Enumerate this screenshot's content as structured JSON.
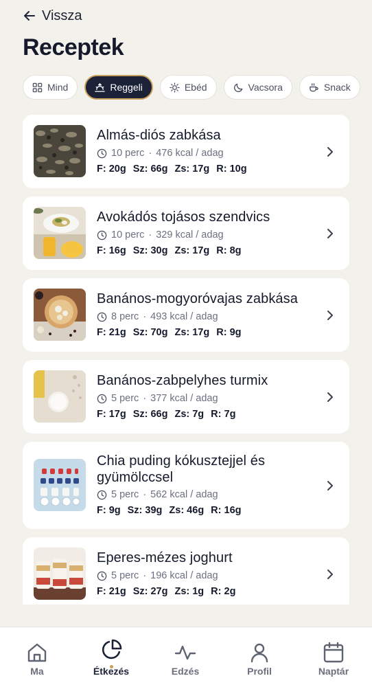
{
  "header": {
    "back_label": "Vissza",
    "title": "Receptek"
  },
  "filters": [
    {
      "label": "Mind",
      "icon": "grid-icon",
      "active": false
    },
    {
      "label": "Reggeli",
      "icon": "sunrise-icon",
      "active": true
    },
    {
      "label": "Ebéd",
      "icon": "sun-icon",
      "active": false
    },
    {
      "label": "Vacsora",
      "icon": "moon-icon",
      "active": false
    },
    {
      "label": "Snack",
      "icon": "cup-icon",
      "active": false
    }
  ],
  "recipes": [
    {
      "name": "Almás-diós zabkása",
      "time": "10 perc",
      "kcal": "476 kcal / adag",
      "macros": {
        "f": "F: 20g",
        "sz": "Sz: 66g",
        "zs": "Zs: 17g",
        "r": "R: 10g"
      }
    },
    {
      "name": "Avokádós tojásos szendvics",
      "time": "10 perc",
      "kcal": "329 kcal / adag",
      "macros": {
        "f": "F: 16g",
        "sz": "Sz: 30g",
        "zs": "Zs: 17g",
        "r": "R: 8g"
      }
    },
    {
      "name": "Banános-mogyoróvajas zabkása",
      "time": "8 perc",
      "kcal": "493 kcal / adag",
      "macros": {
        "f": "F: 21g",
        "sz": "Sz: 70g",
        "zs": "Zs: 17g",
        "r": "R: 9g"
      }
    },
    {
      "name": "Banános-zabpelyhes turmix",
      "time": "5 perc",
      "kcal": "377 kcal / adag",
      "macros": {
        "f": "F: 17g",
        "sz": "Sz: 66g",
        "zs": "Zs: 7g",
        "r": "R: 7g"
      }
    },
    {
      "name": "Chia puding kókusztejjel és gyümölccsel",
      "time": "5 perc",
      "kcal": "562 kcal / adag",
      "macros": {
        "f": "F: 9g",
        "sz": "Sz: 39g",
        "zs": "Zs: 46g",
        "r": "R: 16g"
      }
    },
    {
      "name": "Eperes-mézes joghurt",
      "time": "5 perc",
      "kcal": "196 kcal / adag",
      "macros": {
        "f": "F: 21g",
        "sz": "Sz: 27g",
        "zs": "Zs: 1g",
        "r": "R: 2g"
      }
    }
  ],
  "nav": [
    {
      "label": "Ma",
      "icon": "home-icon",
      "active": false
    },
    {
      "label": "Étkezés",
      "icon": "pie-chart-icon",
      "active": true
    },
    {
      "label": "Edzés",
      "icon": "activity-icon",
      "active": false
    },
    {
      "label": "Profil",
      "icon": "user-icon",
      "active": false
    },
    {
      "label": "Naptár",
      "icon": "calendar-icon",
      "active": false
    }
  ],
  "colors": {
    "background": "#f3f1ec",
    "navy": "#1b2238",
    "gold_accent": "#c9a15c",
    "card": "#ffffff",
    "muted_text": "#6b7080"
  }
}
